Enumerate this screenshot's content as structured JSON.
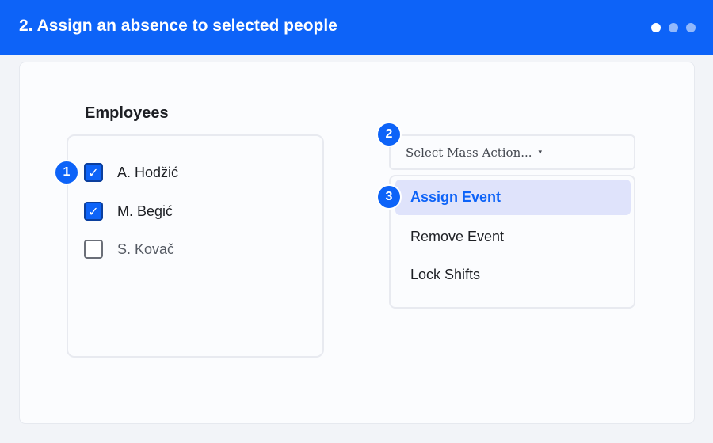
{
  "header": {
    "title": "2. Assign an absence to selected people",
    "step_dots": [
      {
        "active": true
      },
      {
        "active": false
      },
      {
        "active": false
      }
    ]
  },
  "employees": {
    "title": "Employees",
    "items": [
      {
        "name": "A. Hodžić",
        "checked": true
      },
      {
        "name": "M. Begić",
        "checked": true
      },
      {
        "name": "S. Kovač",
        "checked": false
      }
    ]
  },
  "mass_action": {
    "placeholder": "Select Mass Action...",
    "caret": "▾",
    "options": [
      {
        "label": "Assign Event",
        "selected": true
      },
      {
        "label": "Remove Event",
        "selected": false
      },
      {
        "label": "Lock Shifts",
        "selected": false
      }
    ]
  },
  "badges": [
    "1",
    "2",
    "3"
  ],
  "colors": {
    "accent": "#0d63f8",
    "highlight": "#dfe3fb"
  },
  "icons": {
    "checkbox_checked": "check-icon",
    "dropdown": "caret-down-icon"
  }
}
